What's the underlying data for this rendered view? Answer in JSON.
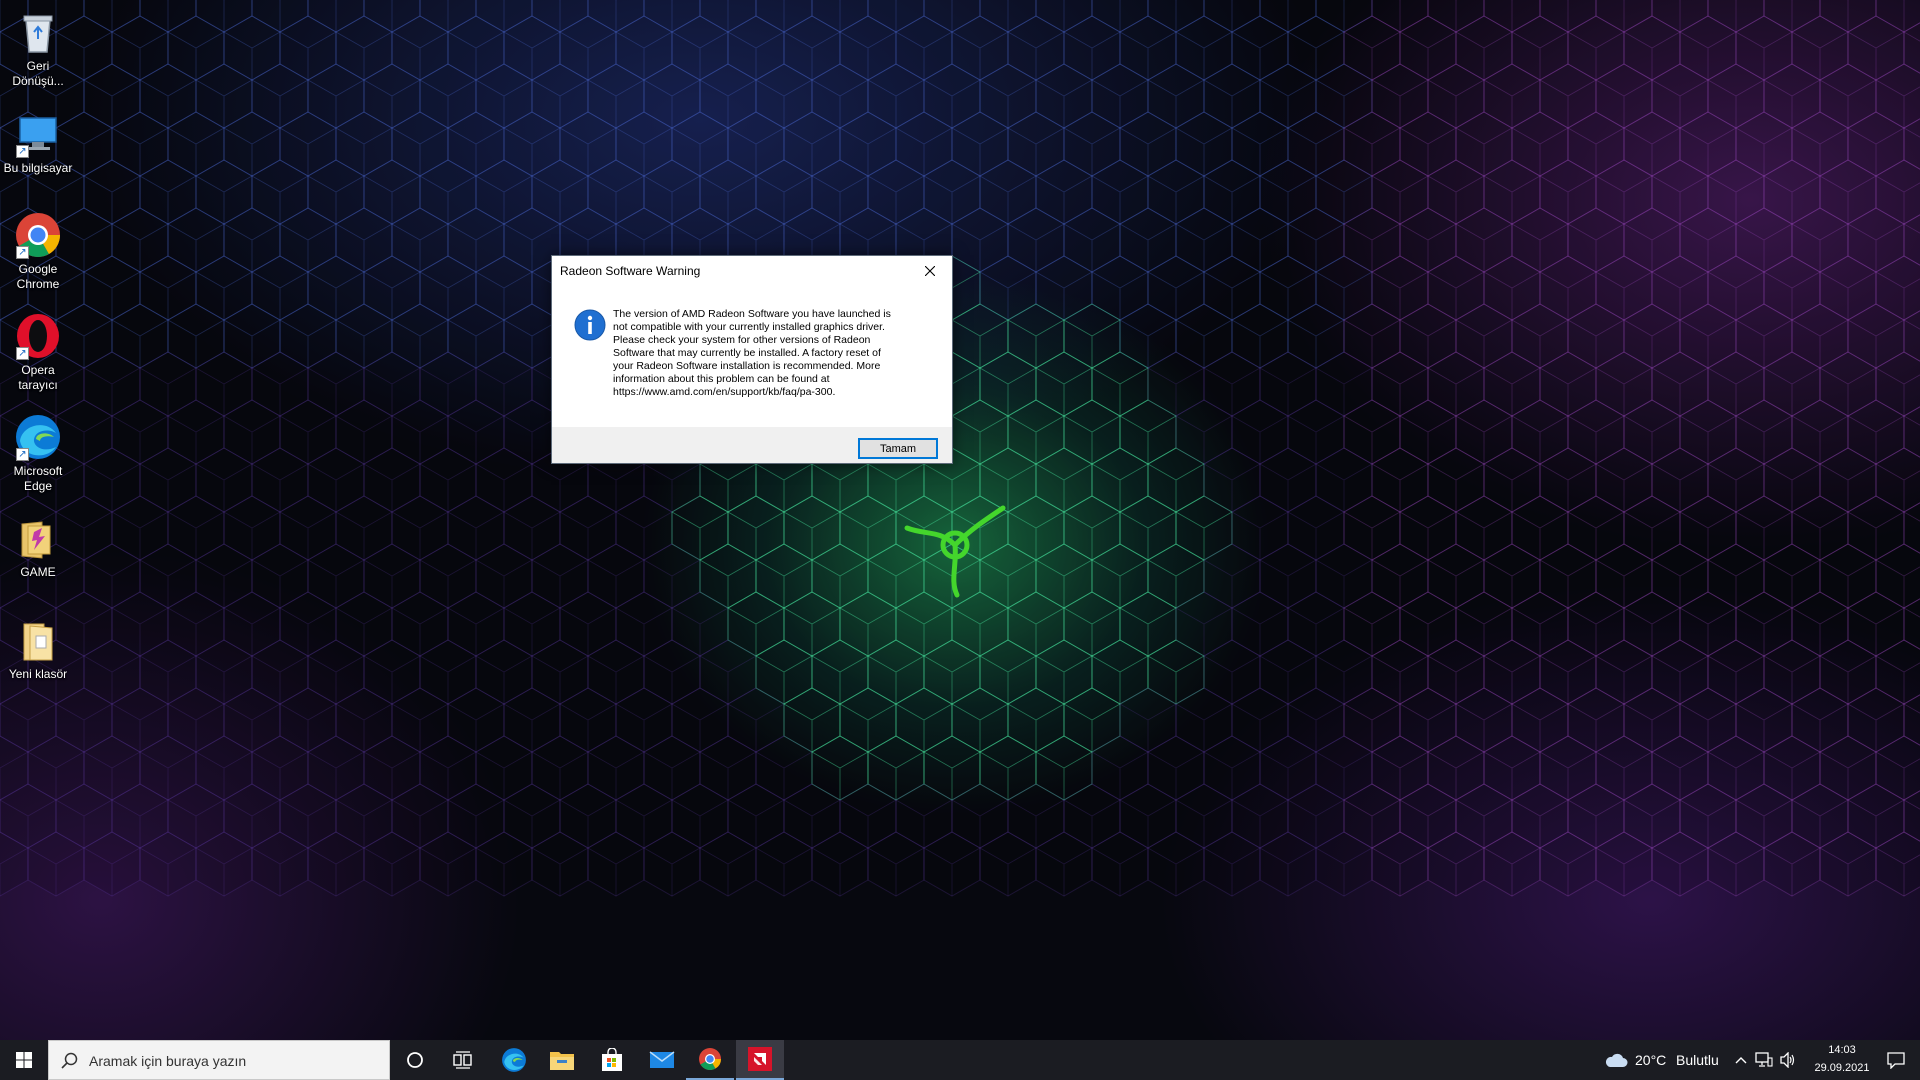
{
  "desktop": {
    "icons": [
      {
        "label": "Geri\nDönüşü...",
        "icon": "recycle-bin-icon"
      },
      {
        "label": "Bu bilgisayar",
        "icon": "this-pc-icon"
      },
      {
        "label": "Google\nChrome",
        "icon": "chrome-icon"
      },
      {
        "label": "Opera\ntarayıcı",
        "icon": "opera-icon"
      },
      {
        "label": "Microsoft\nEdge",
        "icon": "edge-icon"
      },
      {
        "label": "GAME",
        "icon": "game-folder-icon"
      },
      {
        "label": "Yeni klasör",
        "icon": "folder-icon"
      }
    ]
  },
  "dialog": {
    "title": "Radeon Software Warning",
    "message": "The version of AMD Radeon Software you have launched is\nnot compatible with your currently installed graphics driver.\nPlease check your system for other versions of Radeon\nSoftware that may currently be installed. A factory reset of\nyour Radeon Software installation is recommended. More\ninformation about this problem can be found at\nhttps://www.amd.com/en/support/kb/faq/pa-300.",
    "ok_label": "Tamam"
  },
  "taskbar": {
    "search_placeholder": "Aramak için buraya yazın",
    "pinned": [
      "edge-icon",
      "file-explorer-icon",
      "store-icon",
      "mail-icon",
      "chrome-icon",
      "amd-radeon-icon"
    ],
    "weather_temp": "20°C",
    "weather_desc": "Bulutlu",
    "time": "14:03",
    "date": "29.09.2021"
  },
  "colors": {
    "accent": "#0078d7",
    "taskbar_bg": "#1b1c22",
    "razer_green": "#44d62c"
  }
}
